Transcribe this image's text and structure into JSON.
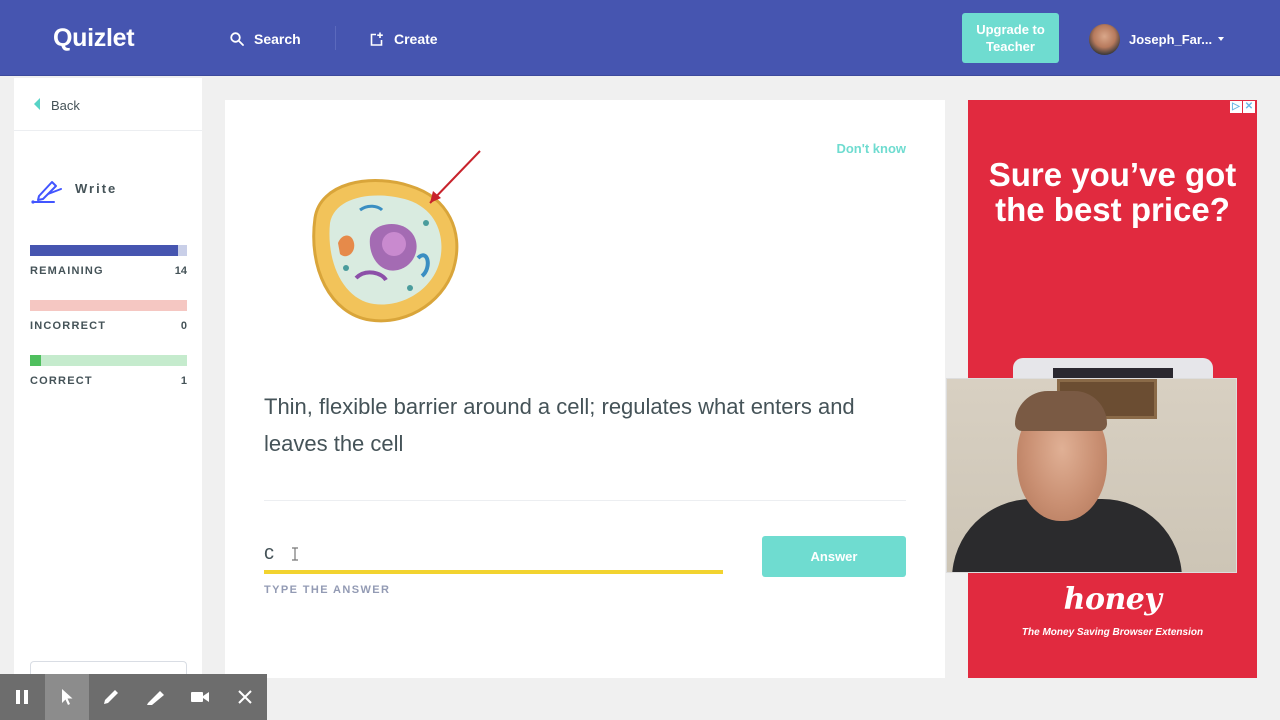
{
  "header": {
    "logo": "Quizlet",
    "search_label": "Search",
    "create_label": "Create",
    "upgrade_label": "Upgrade to Teacher",
    "user_name": "Joseph_Far..."
  },
  "sidebar": {
    "back_label": "Back",
    "mode_label": "Write",
    "stats": [
      {
        "label": "REMAINING",
        "value": "14",
        "fill": 0.94,
        "color": "#4255ff",
        "track": "#c9cfe8"
      },
      {
        "label": "INCORRECT",
        "value": "0",
        "fill": 0.0,
        "color": "#ff725b",
        "track": "#f5c7c2"
      },
      {
        "label": "CORRECT",
        "value": "1",
        "fill": 0.07,
        "color": "#3ccfcf",
        "track": "#c5ebcd"
      }
    ]
  },
  "card": {
    "dont_know_label": "Don't know",
    "prompt": "Thin, flexible barrier around a cell; regulates what enters and leaves the cell",
    "answer_value": "c",
    "type_label": "TYPE THE ANSWER",
    "answer_button": "Answer"
  },
  "ad": {
    "headline": "Sure you’ve got the best price?",
    "brand": "honey",
    "tagline": "The Money Saving Browser Extension"
  },
  "colors": {
    "topbar": "#4655b0",
    "accent": "#6fdcd0",
    "input_underline": "#f2d32f",
    "ad_background": "#e12a3f"
  },
  "recorder_tools": [
    "pause-icon",
    "pointer-icon",
    "pen-icon",
    "highlighter-icon",
    "camera-icon",
    "close-icon"
  ]
}
